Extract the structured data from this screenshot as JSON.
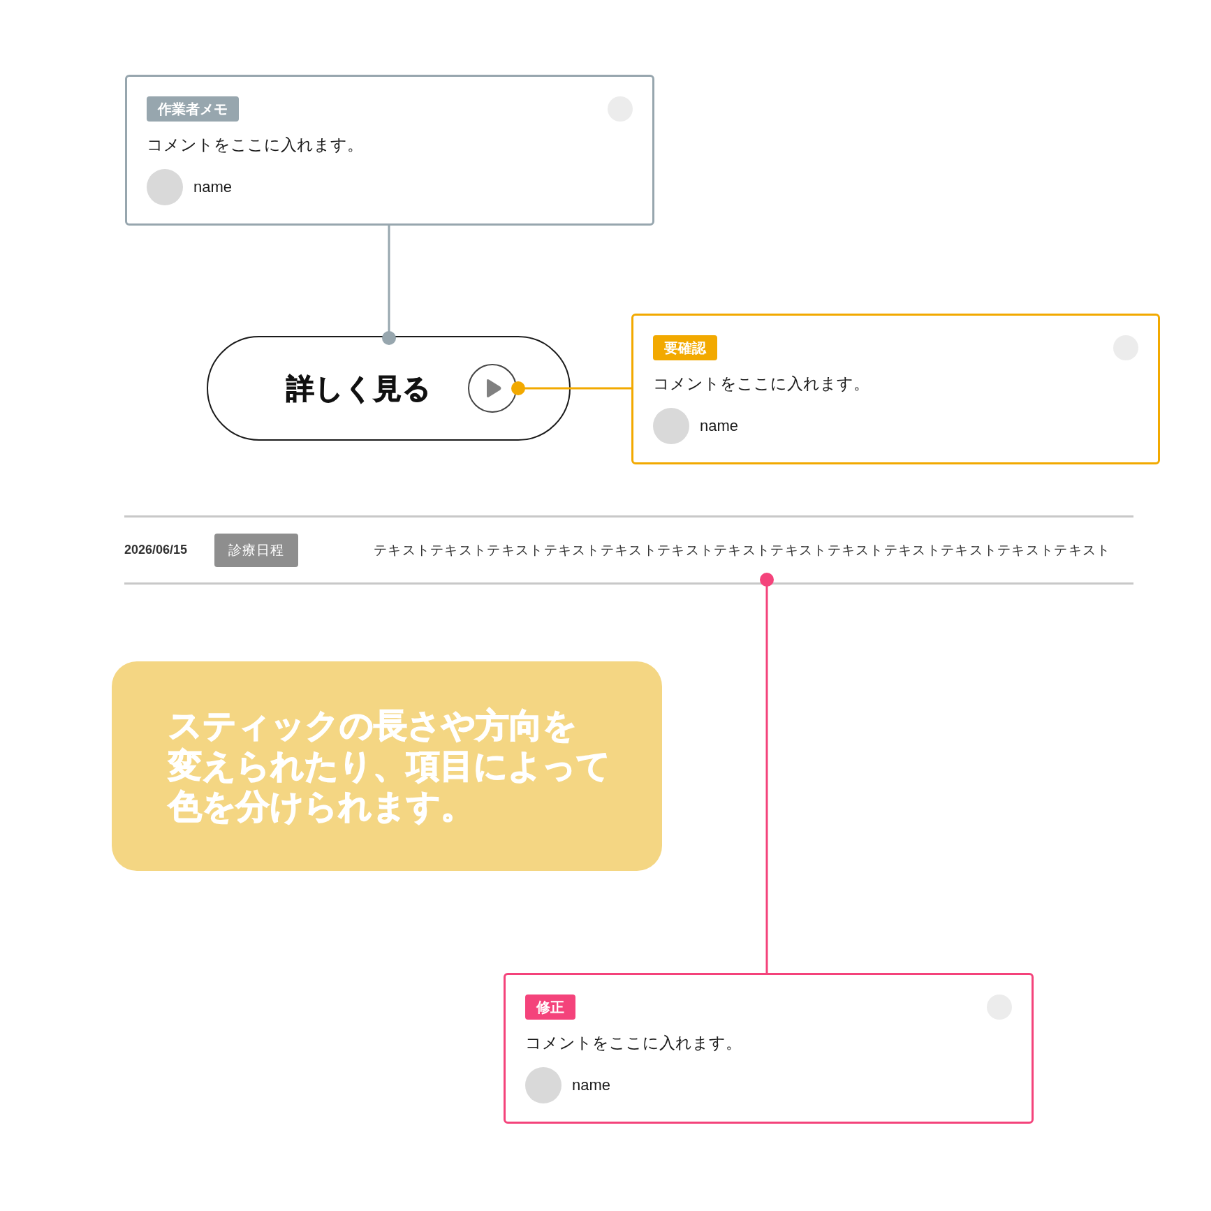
{
  "annotations": [
    {
      "tag": "作業者メモ",
      "color": "#97a6ae",
      "comment": "コメントをここに入れます。",
      "author": "name"
    },
    {
      "tag": "要確認",
      "color": "#f2a900",
      "comment": "コメントをここに入れます。",
      "author": "name"
    },
    {
      "tag": "修正",
      "color": "#f4437b",
      "comment": "コメントをここに入れます。",
      "author": "name"
    }
  ],
  "button": {
    "label": "詳しく見る"
  },
  "schedule_row": {
    "date": "2026/06/15",
    "tag": "診療日程",
    "text": "テキストテキストテキストテキストテキストテキストテキストテキストテキストテキストテキストテキストテキスト"
  },
  "banner": {
    "lines": [
      "スティックの長さや方向を",
      "変えられたり、項目によって",
      "色を分けられます。"
    ]
  }
}
